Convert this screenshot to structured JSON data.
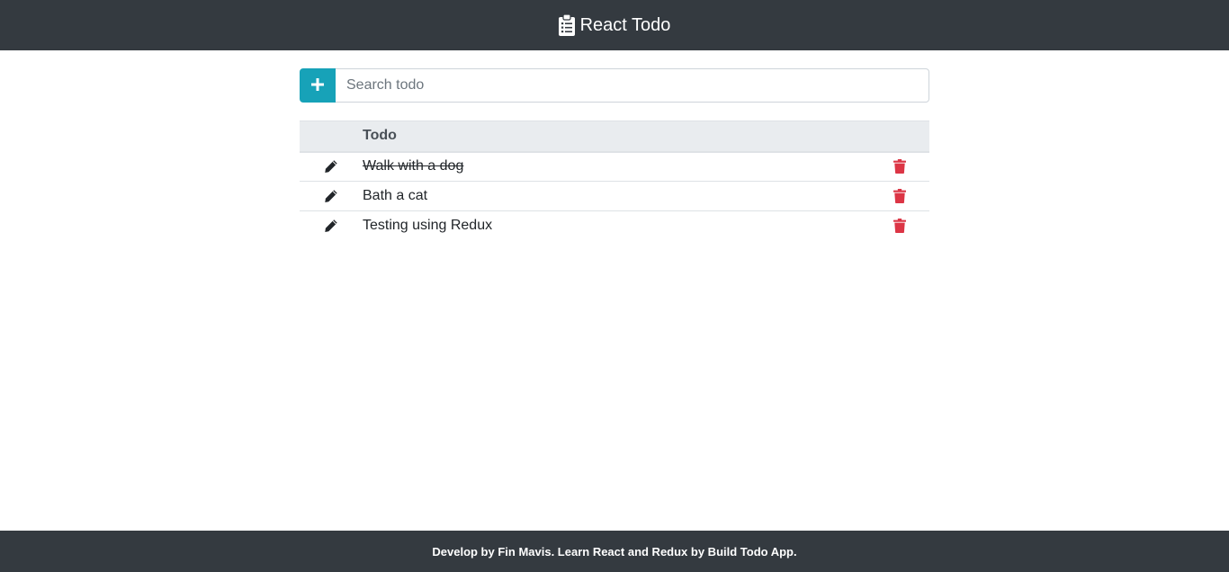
{
  "header": {
    "title": "React Todo",
    "icon": "clipboard-list-icon"
  },
  "search": {
    "placeholder": "Search todo",
    "value": "",
    "add_icon": "plus-icon"
  },
  "table": {
    "header_label": "Todo",
    "rows": [
      {
        "text": "Walk with a dog",
        "completed": true
      },
      {
        "text": "Bath a cat",
        "completed": false
      },
      {
        "text": "Testing using Redux",
        "completed": false
      }
    ]
  },
  "footer": {
    "text": "Develop by Fin Mavis. Learn React and Redux by Build Todo App."
  },
  "colors": {
    "navbar": "#343a40",
    "accent": "#17a2b8",
    "danger": "#dc3545"
  }
}
